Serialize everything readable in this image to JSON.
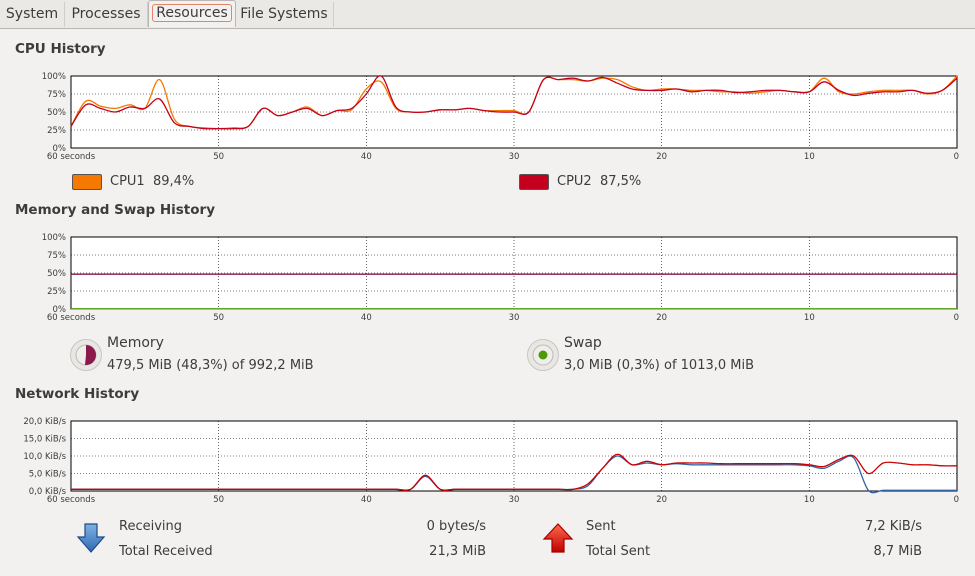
{
  "tabs": [
    {
      "label": "System"
    },
    {
      "label": "Processes"
    },
    {
      "label": "Resources"
    },
    {
      "label": "File Systems"
    }
  ],
  "active_tab": "Resources",
  "colors": {
    "cpu1": "#f57900",
    "cpu2": "#c4001e",
    "memory": "#8b1a4a",
    "swap": "#4e9a06",
    "receiving": "#3465a4",
    "sent": "#cc0000"
  },
  "cpu": {
    "title": "CPU History",
    "y_ticks": [
      "100%",
      "75%",
      "50%",
      "25%",
      "0%"
    ],
    "x_ticks": [
      "60 seconds",
      "50",
      "40",
      "30",
      "20",
      "10",
      "0"
    ],
    "cpu1": {
      "label": "CPU1",
      "value": "89,4%"
    },
    "cpu2": {
      "label": "CPU2",
      "value": "87,5%"
    }
  },
  "memory": {
    "title": "Memory and Swap History",
    "y_ticks": [
      "100%",
      "75%",
      "50%",
      "25%",
      "0%"
    ],
    "x_ticks": [
      "60 seconds",
      "50",
      "40",
      "30",
      "20",
      "10",
      "0"
    ],
    "memory_label": "Memory",
    "memory_value": "479,5 MiB (48,3%) of 992,2 MiB",
    "swap_label": "Swap",
    "swap_value": "3,0 MiB (0,3%) of 1013,0 MiB"
  },
  "network": {
    "title": "Network History",
    "y_ticks": [
      "20,0 KiB/s",
      "15,0 KiB/s",
      "10,0 KiB/s",
      "5,0 KiB/s",
      "0,0 KiB/s"
    ],
    "x_ticks": [
      "60 seconds",
      "50",
      "40",
      "30",
      "20",
      "10",
      "0"
    ],
    "receiving_label": "Receiving",
    "receiving_value": "0 bytes/s",
    "total_received_label": "Total Received",
    "total_received_value": "21,3 MiB",
    "sent_label": "Sent",
    "sent_value": "7,2 KiB/s",
    "total_sent_label": "Total Sent",
    "total_sent_value": "8,7 MiB"
  },
  "chart_data": [
    {
      "type": "line",
      "title": "CPU History",
      "x": [
        60,
        59,
        58,
        57,
        56,
        55,
        54,
        53,
        52,
        51,
        50,
        49,
        48,
        47,
        46,
        45,
        44,
        43,
        42,
        41,
        40,
        39,
        38,
        37,
        36,
        35,
        34,
        33,
        32,
        31,
        30,
        29,
        28,
        27,
        26,
        25,
        24,
        23,
        22,
        21,
        20,
        19,
        18,
        17,
        16,
        15,
        14,
        13,
        12,
        11,
        10,
        9,
        8,
        7,
        6,
        5,
        4,
        3,
        2,
        1,
        0
      ],
      "xlim": [
        60,
        0
      ],
      "ylim": [
        0,
        100
      ],
      "series": [
        {
          "name": "CPU1",
          "values": [
            30,
            65,
            58,
            55,
            60,
            55,
            95,
            40,
            30,
            28,
            27,
            28,
            30,
            55,
            45,
            50,
            57,
            45,
            52,
            53,
            82,
            92,
            55,
            50,
            50,
            53,
            53,
            55,
            52,
            52,
            52,
            50,
            95,
            95,
            95,
            93,
            97,
            95,
            85,
            80,
            82,
            82,
            80,
            80,
            78,
            78,
            76,
            78,
            80,
            78,
            78,
            97,
            78,
            75,
            78,
            80,
            80,
            80,
            75,
            80,
            100
          ]
        },
        {
          "name": "CPU2",
          "values": [
            30,
            60,
            55,
            50,
            57,
            55,
            68,
            35,
            30,
            27,
            27,
            27,
            30,
            55,
            45,
            50,
            55,
            45,
            52,
            55,
            75,
            100,
            57,
            50,
            50,
            53,
            53,
            55,
            52,
            50,
            50,
            50,
            95,
            95,
            97,
            93,
            98,
            90,
            82,
            80,
            80,
            82,
            78,
            80,
            80,
            77,
            78,
            80,
            80,
            78,
            78,
            92,
            80,
            73,
            76,
            78,
            78,
            80,
            76,
            80,
            97
          ]
        }
      ]
    },
    {
      "type": "line",
      "title": "Memory and Swap History",
      "x": [
        60,
        0
      ],
      "xlim": [
        60,
        0
      ],
      "ylim": [
        0,
        100
      ],
      "series": [
        {
          "name": "Memory",
          "values": [
            48.3,
            48.3
          ]
        },
        {
          "name": "Swap",
          "values": [
            0.3,
            0.3
          ]
        }
      ]
    },
    {
      "type": "line",
      "title": "Network History",
      "x": [
        60,
        59,
        58,
        57,
        56,
        55,
        54,
        53,
        52,
        51,
        50,
        49,
        48,
        47,
        46,
        45,
        44,
        43,
        42,
        41,
        40,
        39,
        38,
        37,
        36,
        35,
        34,
        33,
        32,
        31,
        30,
        29,
        28,
        27,
        26,
        25,
        24,
        23,
        22,
        21,
        20,
        19,
        18,
        17,
        16,
        15,
        14,
        13,
        12,
        11,
        10,
        9,
        8,
        7,
        6,
        5,
        4,
        3,
        2,
        1,
        0
      ],
      "xlim": [
        60,
        0
      ],
      "ylim": [
        0,
        20
      ],
      "series": [
        {
          "name": "Receiving",
          "values": [
            0.5,
            0.5,
            0.5,
            0.5,
            0.5,
            0.5,
            0.5,
            0.5,
            0.5,
            0.5,
            0.5,
            0.5,
            0.5,
            0.5,
            0.5,
            0.5,
            0.5,
            0.5,
            0.5,
            0.5,
            0.5,
            0.5,
            0.5,
            0.5,
            4.2,
            0.5,
            0.5,
            0.5,
            0.5,
            0.5,
            0.5,
            0.5,
            0.5,
            0.5,
            0.5,
            1.5,
            6.5,
            10.0,
            7.5,
            8.0,
            7.5,
            7.8,
            7.5,
            7.5,
            7.5,
            7.5,
            7.5,
            7.5,
            7.5,
            7.5,
            7.2,
            6.5,
            8.5,
            9.5,
            0.2,
            0.2,
            0.2,
            0.2,
            0.2,
            0.2,
            0.2
          ]
        },
        {
          "name": "Sent",
          "values": [
            0.5,
            0.5,
            0.5,
            0.5,
            0.5,
            0.5,
            0.5,
            0.5,
            0.5,
            0.5,
            0.5,
            0.5,
            0.5,
            0.5,
            0.5,
            0.5,
            0.5,
            0.5,
            0.5,
            0.5,
            0.5,
            0.5,
            0.5,
            0.5,
            4.5,
            0.5,
            0.5,
            0.5,
            0.5,
            0.5,
            0.5,
            0.5,
            0.5,
            0.5,
            0.5,
            2.0,
            6.5,
            10.5,
            7.5,
            8.5,
            7.5,
            8.0,
            8.0,
            8.0,
            7.8,
            7.8,
            7.8,
            7.8,
            7.8,
            7.8,
            7.5,
            7.0,
            9.0,
            10.0,
            5.0,
            8.0,
            8.0,
            7.5,
            7.5,
            7.2,
            7.2
          ]
        }
      ]
    }
  ]
}
